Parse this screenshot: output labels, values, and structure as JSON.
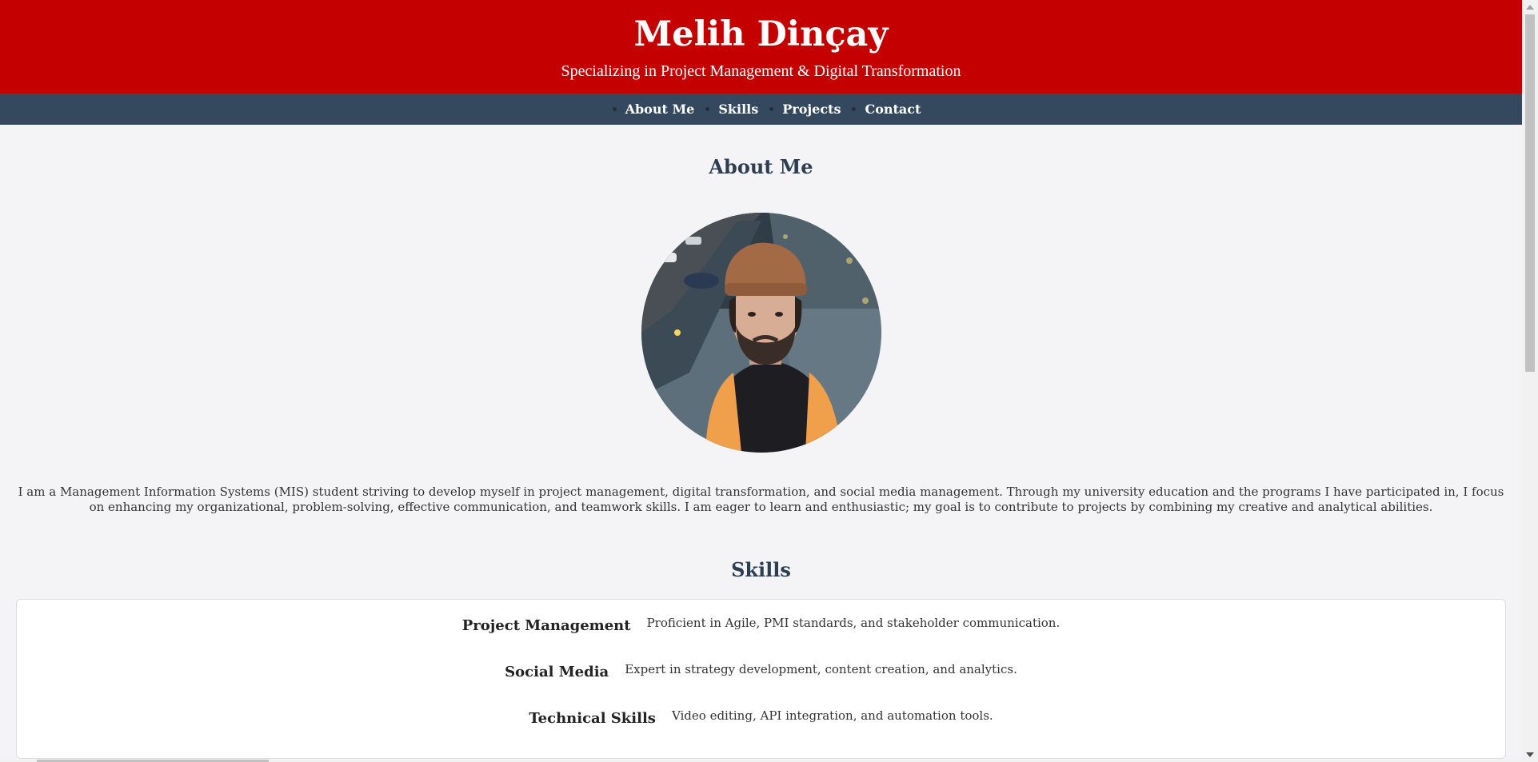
{
  "header": {
    "title": "Melih Dinçay",
    "subtitle": "Specializing in Project Management & Digital Transformation",
    "background_color": "#c40000"
  },
  "nav": {
    "background_color": "#34495e",
    "items": [
      {
        "label": "About Me"
      },
      {
        "label": "Skills"
      },
      {
        "label": "Projects"
      },
      {
        "label": "Contact"
      }
    ]
  },
  "about": {
    "heading": "About Me",
    "photo_icon": "profile-photo",
    "text": "I am a Management Information Systems (MIS) student striving to develop myself in project management, digital transformation, and social media management. Through my university education and the programs I have participated in, I focus on enhancing my organizational, problem-solving, effective communication, and teamwork skills. I am eager to learn and enthusiastic; my goal is to contribute to projects by combining my creative and analytical abilities."
  },
  "skills": {
    "heading": "Skills",
    "items": [
      {
        "name": "Project Management",
        "description": "Proficient in Agile, PMI standards, and stakeholder communication."
      },
      {
        "name": "Social Media",
        "description": "Expert in strategy development, content creation, and analytics."
      },
      {
        "name": "Technical Skills",
        "description": "Video editing, API integration, and automation tools."
      }
    ]
  },
  "colors": {
    "heading": "#2c3e50",
    "page_background": "#f4f4f7"
  }
}
